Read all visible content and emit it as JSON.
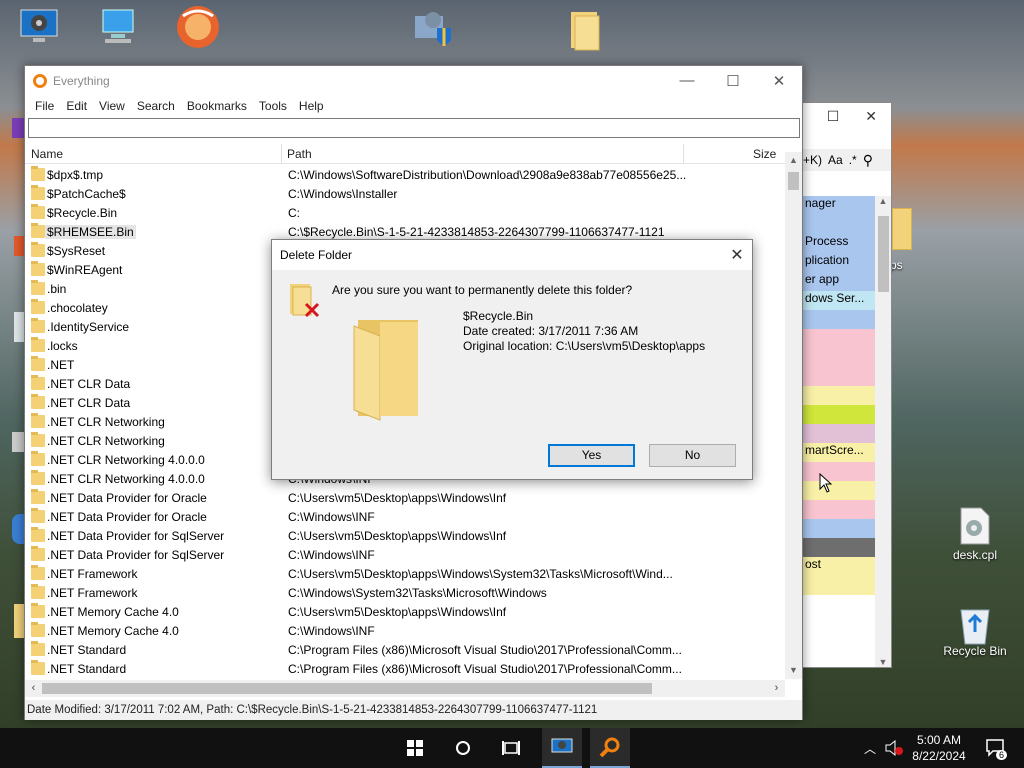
{
  "desktop": {
    "icons": [
      {
        "label": "System Info",
        "name": "desktop-icon-system"
      },
      {
        "label": "This PC",
        "name": "desktop-icon-pc"
      },
      {
        "label": "Firefox",
        "name": "desktop-icon-browser"
      },
      {
        "label": "",
        "name": "desktop-icon-installer"
      },
      {
        "label": "Data",
        "name": "desktop-icon-folder"
      }
    ],
    "deskcpl_label": "desk.cpl",
    "recycle_label": "Recycle Bin"
  },
  "background_window": {
    "search_hint": "+K)",
    "aa_label": "Aa",
    "star_label": ".*",
    "rows": [
      "nager",
      "",
      "Process",
      "plication",
      "er app",
      "dows Ser...",
      "",
      "",
      "",
      "",
      "",
      "",
      "",
      "martScre...",
      "",
      "",
      "",
      "",
      "",
      "ost",
      ""
    ],
    "row_colors": [
      "#a9c6ef",
      "#a9c6ef",
      "#a9c6ef",
      "#a9c6ef",
      "#a9c6ef",
      "#bfe6f2",
      "#a9c6ef",
      "#f7c4cf",
      "#f7c4cf",
      "#f7c4cf",
      "#f8f0a6",
      "#d0e63a",
      "#e2c0d6",
      "#f8f0a6",
      "#f7c4cf",
      "#f8f0a6",
      "#f7c4cf",
      "#a9c6ef",
      "#6e6e6e",
      "#f8f0a6",
      "#f8f0a6"
    ]
  },
  "everything": {
    "title": "Everything",
    "menu": [
      "File",
      "Edit",
      "View",
      "Search",
      "Bookmarks",
      "Tools",
      "Help"
    ],
    "search_value": "",
    "columns": {
      "name": "Name",
      "path": "Path",
      "size": "Size"
    },
    "rows": [
      {
        "name": "$dpx$.tmp",
        "path": "C:\\Windows\\SoftwareDistribution\\Download\\2908a9e838ab77e08556e25..."
      },
      {
        "name": "$PatchCache$",
        "path": "C:\\Windows\\Installer"
      },
      {
        "name": "$Recycle.Bin",
        "path": "C:"
      },
      {
        "name": "$RHEMSEE.Bin",
        "path": "C:\\$Recycle.Bin\\S-1-5-21-4233814853-2264307799-1106637477-1121"
      },
      {
        "name": "$SysReset",
        "path": ""
      },
      {
        "name": "$WinREAgent",
        "path": ""
      },
      {
        "name": ".bin",
        "path": ""
      },
      {
        "name": ".chocolatey",
        "path": ""
      },
      {
        "name": ".IdentityService",
        "path": ""
      },
      {
        "name": ".locks",
        "path": ""
      },
      {
        "name": ".NET",
        "path": ""
      },
      {
        "name": ".NET CLR Data",
        "path": ""
      },
      {
        "name": ".NET CLR Data",
        "path": ""
      },
      {
        "name": ".NET CLR Networking",
        "path": ""
      },
      {
        "name": ".NET CLR Networking",
        "path": ""
      },
      {
        "name": ".NET CLR Networking 4.0.0.0",
        "path": ""
      },
      {
        "name": ".NET CLR Networking 4.0.0.0",
        "path": "C:\\Windows\\INF"
      },
      {
        "name": ".NET Data Provider for Oracle",
        "path": "C:\\Users\\vm5\\Desktop\\apps\\Windows\\Inf"
      },
      {
        "name": ".NET Data Provider for Oracle",
        "path": "C:\\Windows\\INF"
      },
      {
        "name": ".NET Data Provider for SqlServer",
        "path": "C:\\Users\\vm5\\Desktop\\apps\\Windows\\Inf"
      },
      {
        "name": ".NET Data Provider for SqlServer",
        "path": "C:\\Windows\\INF"
      },
      {
        "name": ".NET Framework",
        "path": "C:\\Users\\vm5\\Desktop\\apps\\Windows\\System32\\Tasks\\Microsoft\\Wind..."
      },
      {
        "name": ".NET Framework",
        "path": "C:\\Windows\\System32\\Tasks\\Microsoft\\Windows"
      },
      {
        "name": ".NET Memory Cache 4.0",
        "path": "C:\\Users\\vm5\\Desktop\\apps\\Windows\\Inf"
      },
      {
        "name": ".NET Memory Cache 4.0",
        "path": "C:\\Windows\\INF"
      },
      {
        "name": ".NET Standard",
        "path": "C:\\Program Files (x86)\\Microsoft Visual Studio\\2017\\Professional\\Comm..."
      },
      {
        "name": ".NET Standard",
        "path": "C:\\Program Files (x86)\\Microsoft Visual Studio\\2017\\Professional\\Comm..."
      }
    ],
    "status": "Date Modified: 3/17/2011 7:02 AM, Path: C:\\$Recycle.Bin\\S-1-5-21-4233814853-2264307799-1106637477-1121"
  },
  "dialog": {
    "title": "Delete Folder",
    "question": "Are you sure you want to permanently delete this folder?",
    "item_name": "$Recycle.Bin",
    "date_created": "Date created: 3/17/2011 7:36 AM",
    "original_location": "Original location: C:\\Users\\vm5\\Desktop\\apps",
    "yes_label": "Yes",
    "no_label": "No"
  },
  "taskbar": {
    "time": "5:00 AM",
    "date": "8/22/2024",
    "notification_count": "6"
  }
}
